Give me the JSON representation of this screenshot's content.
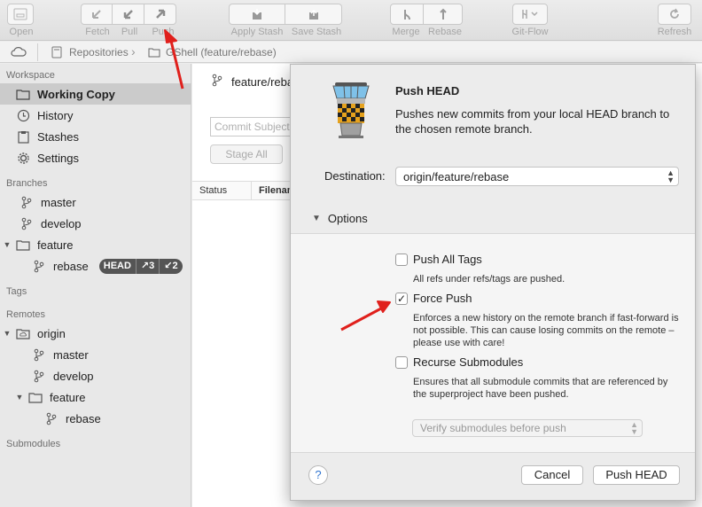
{
  "toolbar": {
    "open_label": "Open",
    "fetch_label": "Fetch",
    "pull_label": "Pull",
    "push_label": "Push",
    "apply_stash_label": "Apply Stash",
    "save_stash_label": "Save Stash",
    "merge_label": "Merge",
    "rebase_label": "Rebase",
    "gitflow_label": "Git-Flow",
    "refresh_label": "Refresh"
  },
  "pathbar": {
    "repositories_label": "Repositories",
    "current_label": "GShell (feature/rebase)"
  },
  "sidebar": {
    "workspace_header": "Workspace",
    "workspace_items": [
      "Working Copy",
      "History",
      "Stashes",
      "Settings"
    ],
    "branches_header": "Branches",
    "branches": [
      "master",
      "develop"
    ],
    "feature_folder": "feature",
    "feature_branch": "rebase",
    "head_badge": {
      "head": "HEAD",
      "ahead": "↗3",
      "behind": "↙2"
    },
    "tags_header": "Tags",
    "remotes_header": "Remotes",
    "remote_name": "origin",
    "remote_branches": [
      "master",
      "develop"
    ],
    "remote_feature_folder": "feature",
    "remote_feature_branch": "rebase",
    "submodules_header": "Submodules"
  },
  "main": {
    "branch_title": "feature/rebase",
    "commit_placeholder": "Commit Subject",
    "stage_all_label": "Stage All",
    "col_status": "Status",
    "col_filename": "Filename"
  },
  "dialog": {
    "title": "Push HEAD",
    "description": "Pushes new commits from your local HEAD branch to the chosen remote branch.",
    "destination_label": "Destination:",
    "destination_value": "origin/feature/rebase",
    "options_label": "Options",
    "push_all_tags_label": "Push All Tags",
    "push_all_tags_checked": false,
    "push_all_tags_desc": "All refs under refs/tags are pushed.",
    "force_push_label": "Force Push",
    "force_push_checked": true,
    "force_push_desc": "Enforces a new history on the remote branch if fast-forward is not possible. This can cause losing commits on the remote – please use with care!",
    "recurse_label": "Recurse Submodules",
    "recurse_checked": false,
    "recurse_desc": "Ensures that all submodule commits that are referenced by the superproject have been pushed.",
    "verify_select_value": "Verify submodules before push",
    "help_label": "?",
    "cancel_label": "Cancel",
    "push_button_label": "Push HEAD"
  },
  "colors": {
    "annotation_arrow": "#e0201c",
    "selection": "#cbcbcb",
    "badge": "#555555"
  }
}
